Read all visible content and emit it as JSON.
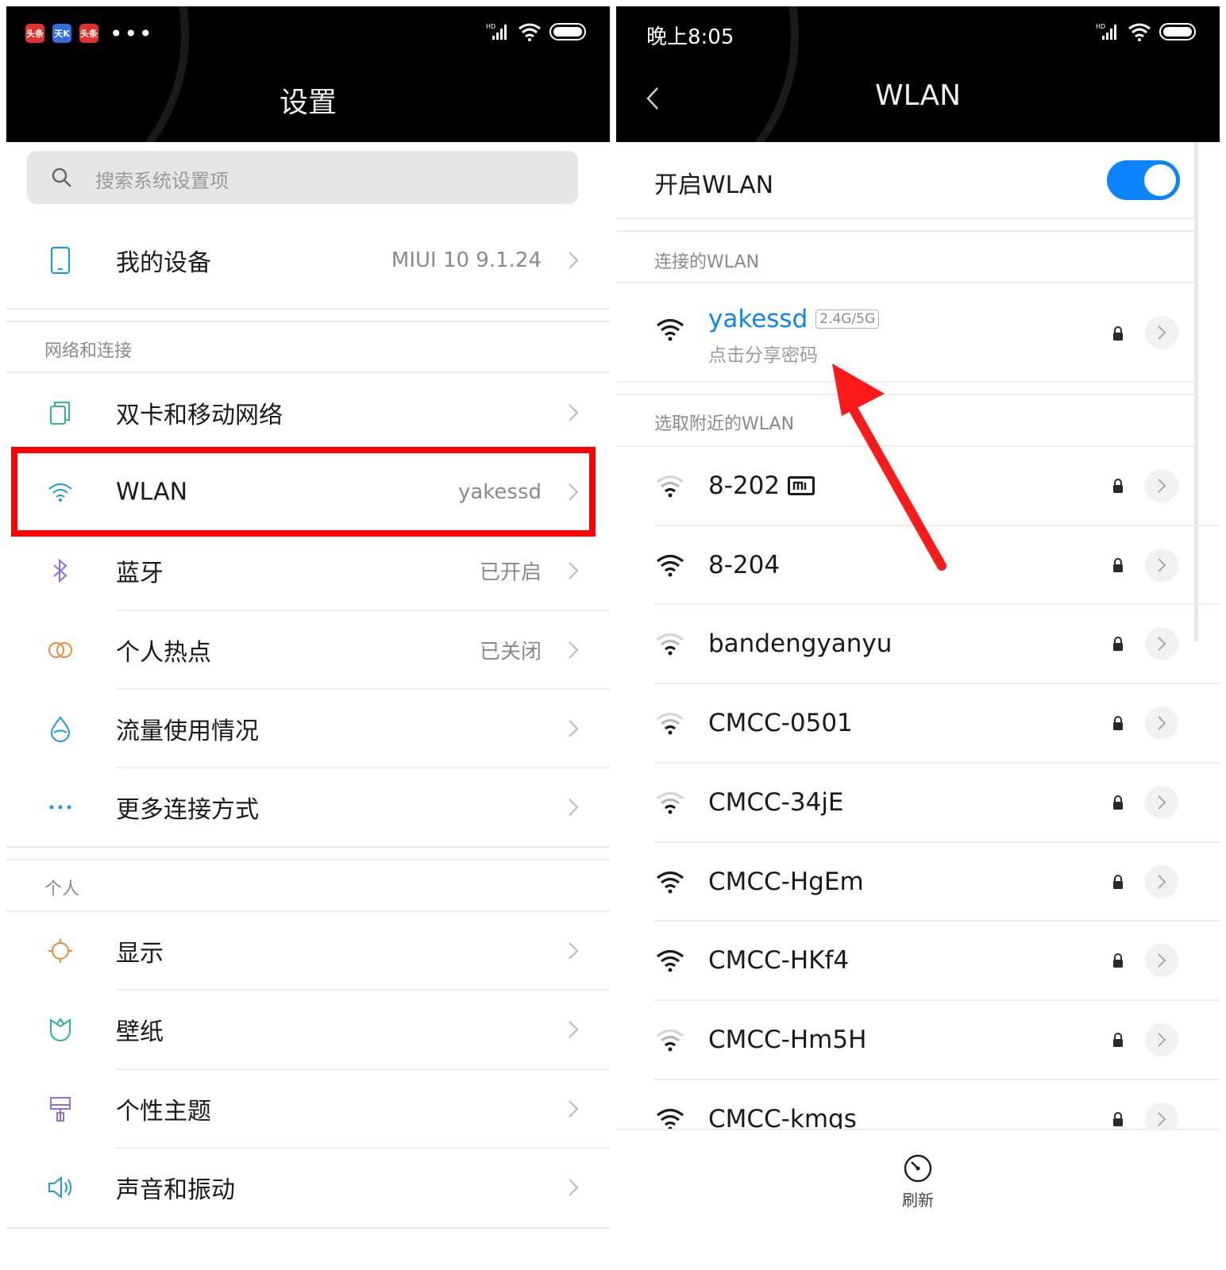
{
  "left": {
    "title": "设置",
    "search_placeholder": "搜索系统设置项",
    "status_apps": [
      "头条",
      "天K",
      "头条"
    ],
    "my_device": {
      "label": "我的设备",
      "value": "MIUI 10 9.1.24"
    },
    "section_network": "网络和连接",
    "network_items": [
      {
        "label": "双卡和移动网络",
        "value": ""
      },
      {
        "label": "WLAN",
        "value": "yakessd"
      },
      {
        "label": "蓝牙",
        "value": "已开启"
      },
      {
        "label": "个人热点",
        "value": "已关闭"
      },
      {
        "label": "流量使用情况",
        "value": ""
      },
      {
        "label": "更多连接方式",
        "value": ""
      }
    ],
    "section_personal": "个人",
    "personal_items": [
      {
        "label": "显示"
      },
      {
        "label": "壁纸"
      },
      {
        "label": "个性主题"
      },
      {
        "label": "声音和振动"
      }
    ]
  },
  "right": {
    "time": "晚上8:05",
    "title": "WLAN",
    "toggle_label": "开启WLAN",
    "toggle_on": true,
    "section_connected": "连接的WLAN",
    "connected": {
      "name": "yakessd",
      "band": "2.4G/5G",
      "sub": "点击分享密码"
    },
    "section_nearby": "选取附近的WLAN",
    "networks": [
      {
        "name": "8-202",
        "strength": "weak",
        "mi": true
      },
      {
        "name": "8-204",
        "strength": "strong"
      },
      {
        "name": "bandengyanyu",
        "strength": "weak"
      },
      {
        "name": "CMCC-0501",
        "strength": "weak"
      },
      {
        "name": "CMCC-34jE",
        "strength": "weak"
      },
      {
        "name": "CMCC-HgEm",
        "strength": "strong"
      },
      {
        "name": "CMCC-HKf4",
        "strength": "strong"
      },
      {
        "name": "CMCC-Hm5H",
        "strength": "weak"
      },
      {
        "name": "CMCC-kmqs",
        "strength": "strong"
      }
    ],
    "refresh_label": "刷新"
  },
  "colors": {
    "accent": "#0d84ff",
    "highlight": "#ff0000",
    "arrow": "#ff0000",
    "header": "#000000"
  }
}
